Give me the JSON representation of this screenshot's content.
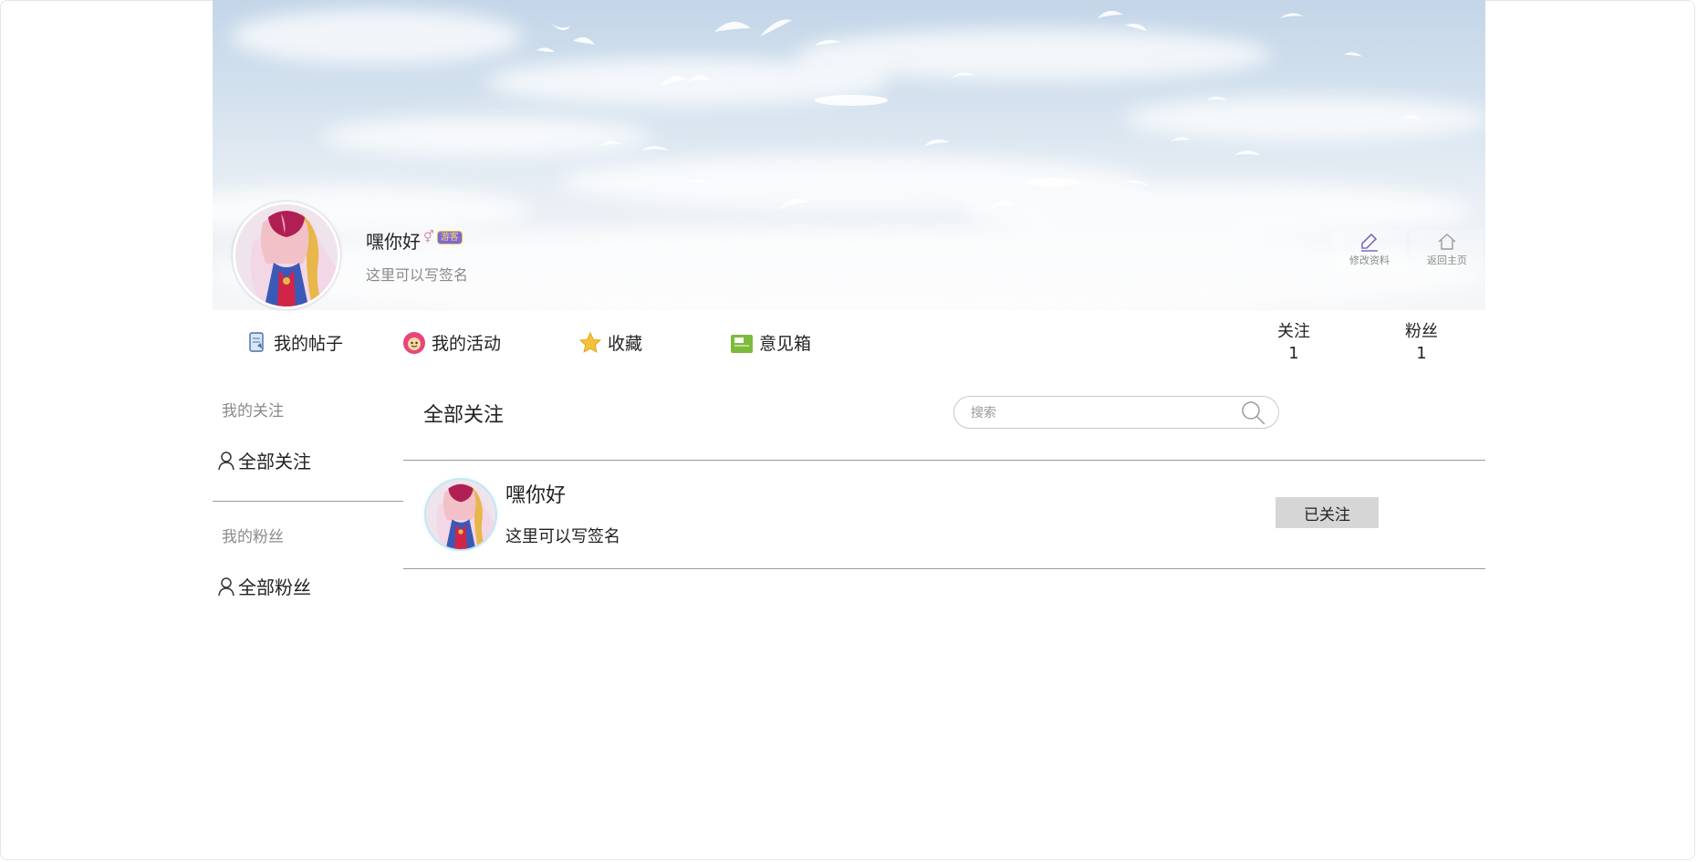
{
  "profile": {
    "name": "嘿你好",
    "gender_symbol": "⚥",
    "badge": "游客",
    "signature": "这里可以写签名",
    "edit_label": "修改资料",
    "home_label": "返回主页"
  },
  "nav": {
    "posts": "我的帖子",
    "activity": "我的活动",
    "favorites": "收藏",
    "feedback": "意见箱"
  },
  "stats": {
    "following_label": "关注",
    "following_count": "1",
    "fans_label": "粉丝",
    "fans_count": "1"
  },
  "sidebar": {
    "following_heading": "我的关注",
    "all_following": "全部关注",
    "fans_heading": "我的粉丝",
    "all_fans": "全部粉丝"
  },
  "main": {
    "title": "全部关注",
    "search_placeholder": "搜索",
    "rows": [
      {
        "name": "嘿你好",
        "signature": "这里可以写签名",
        "button": "已关注"
      }
    ]
  },
  "colors": {
    "sky_top": "#c3d5e8",
    "badge_bg": "#7a69d6",
    "button_bg": "#d6d6d6",
    "divider": "#9a9a9a"
  }
}
